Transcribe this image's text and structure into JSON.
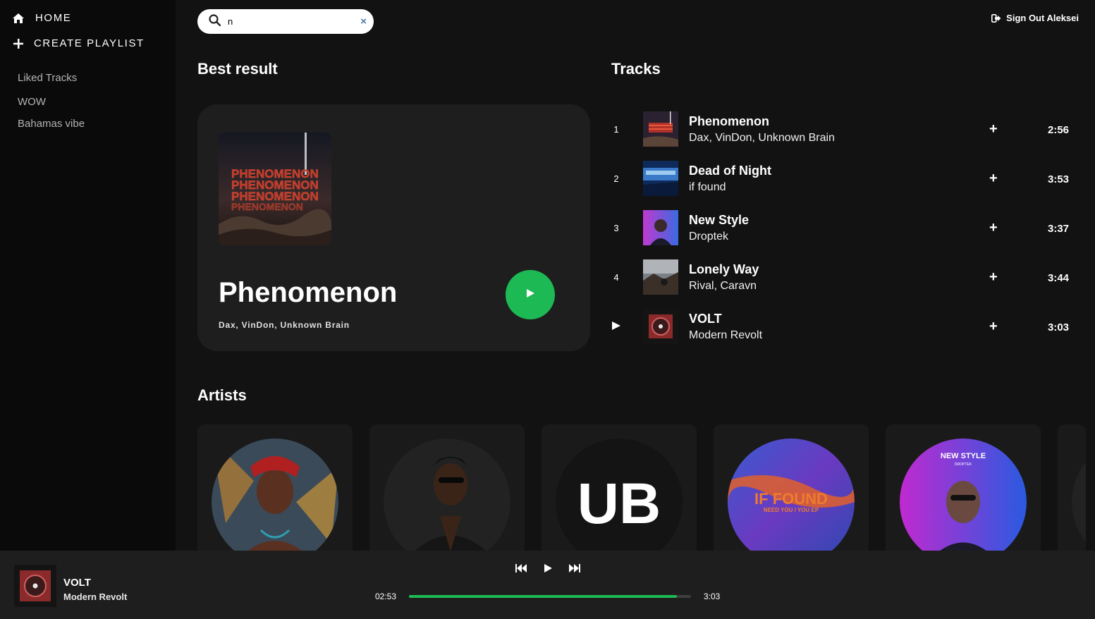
{
  "sidebar": {
    "home_label": "HOME",
    "create_label": "CREATE PLAYLIST",
    "playlists": [
      "Liked Tracks",
      "WOW",
      "Bahamas vibe"
    ]
  },
  "search": {
    "value": "n",
    "clear": "×"
  },
  "header": {
    "signout_label": "Sign Out Aleksei"
  },
  "best": {
    "section_title": "Best result",
    "title": "Phenomenon",
    "artists": "Dax, VinDon, Unknown Brain",
    "cover_text": "PHENOMENON"
  },
  "tracks": {
    "section_title": "Tracks",
    "items": [
      {
        "num": "1",
        "name": "Phenomenon",
        "artists": "Dax, VinDon, Unknown Brain",
        "duration": "2:56",
        "add": "+"
      },
      {
        "num": "2",
        "name": "Dead of Night",
        "artists": "if found",
        "duration": "3:53",
        "add": "+"
      },
      {
        "num": "3",
        "name": "New Style",
        "artists": "Droptek",
        "duration": "3:37",
        "add": "+"
      },
      {
        "num": "4",
        "name": "Lonely Way",
        "artists": "Rival, Caravn",
        "duration": "3:44",
        "add": "+"
      },
      {
        "num": "",
        "name": "VOLT",
        "artists": "Modern Revolt",
        "duration": "3:03",
        "add": "+"
      }
    ]
  },
  "artists": {
    "section_title": "Artists",
    "logo_text": "UB",
    "iffound_line1": "IF FOUND",
    "iffound_line2": "NEED YOU / YOU EP",
    "newstyle_title": "NEW STYLE",
    "newstyle_sub": "DROPTEK"
  },
  "player": {
    "title": "VOLT",
    "artist": "Modern Revolt",
    "elapsed": "02:53",
    "total": "3:03",
    "progress": 0.95
  },
  "colors": {
    "accent": "#1db954",
    "background": "#121212",
    "sidebar": "#0a0a0a",
    "card": "#1e1e1e"
  }
}
